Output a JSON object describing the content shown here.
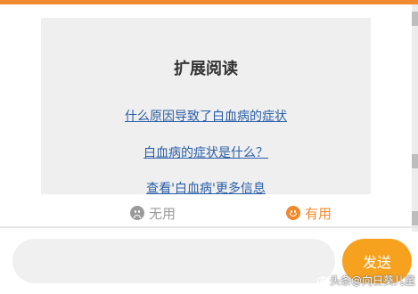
{
  "card": {
    "title": "扩展阅读",
    "links": [
      "什么原因导致了白血病的症状",
      "白血病的症状是什么？",
      "查看'白血病'更多信息"
    ]
  },
  "feedback": {
    "useless_label": "无用",
    "useful_label": "有用"
  },
  "composer": {
    "input_value": "",
    "send_label": "发送"
  },
  "watermark": {
    "text": "头条@向日葵儿童"
  },
  "colors": {
    "accent": "#f08a2c",
    "send_button": "#f7a21e",
    "link": "#2a5ea8",
    "card_bg": "#efefef"
  },
  "icons": {
    "useless": "sad-face-icon",
    "useful": "happy-face-icon"
  }
}
